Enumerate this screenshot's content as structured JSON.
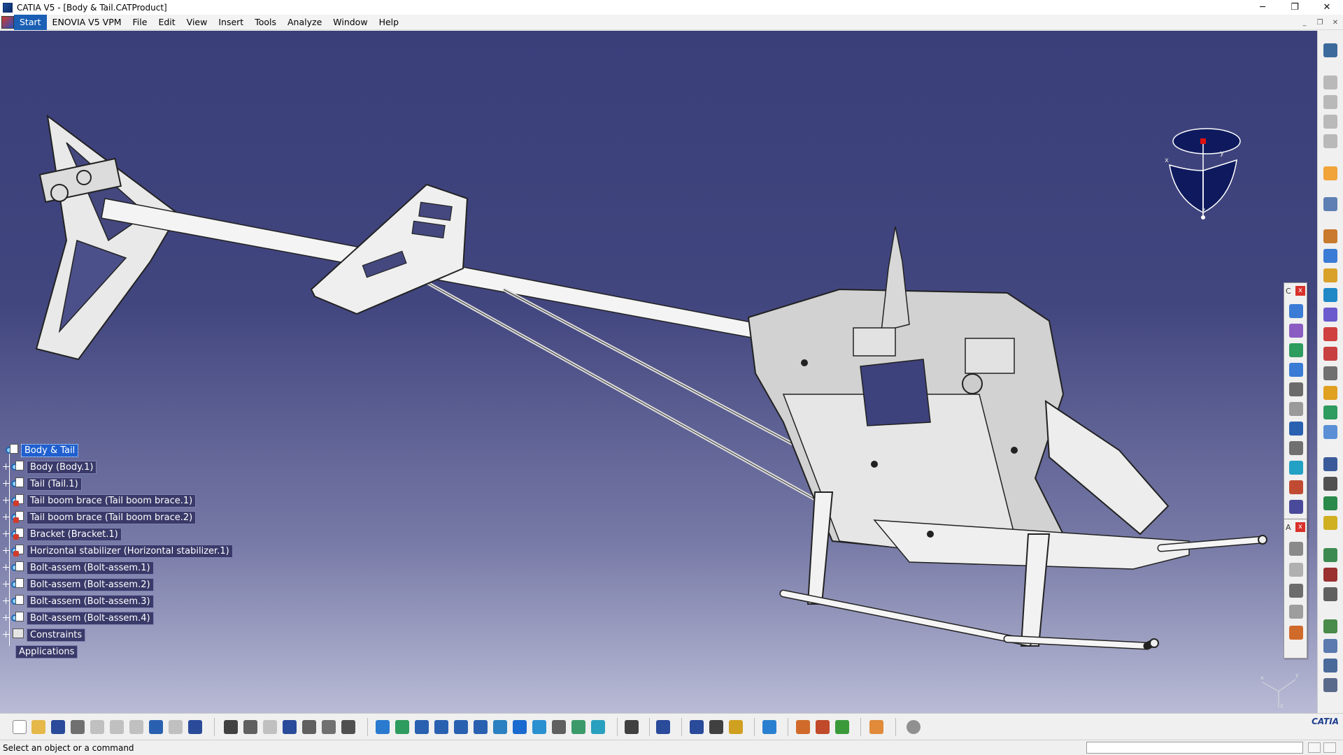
{
  "window": {
    "title": "CATIA V5 - [Body & Tail.CATProduct]",
    "controls": {
      "minimize": "─",
      "restore": "❐",
      "close": "✕"
    }
  },
  "menu": {
    "items": [
      "Start",
      "ENOVIA V5 VPM",
      "File",
      "Edit",
      "View",
      "Insert",
      "Tools",
      "Analyze",
      "Window",
      "Help"
    ],
    "active_index": 0
  },
  "tree": {
    "root": "Body & Tail",
    "children": [
      "Body (Body.1)",
      "Tail (Tail.1)",
      "Tail boom brace (Tail boom brace.1)",
      "Tail boom brace (Tail boom brace.2)",
      "Bracket (Bracket.1)",
      "Horizontal stabilizer (Horizontal stabilizer.1)",
      "Bolt-assem (Bolt-assem.1)",
      "Bolt-assem (Bolt-assem.2)",
      "Bolt-assem (Bolt-assem.3)",
      "Bolt-assem (Bolt-assem.4)",
      "Constraints",
      "Applications"
    ]
  },
  "floating_toolbars": [
    {
      "title": "C",
      "close": "x"
    },
    {
      "title": "A",
      "close": "x"
    }
  ],
  "compass": {
    "axis_x": "x",
    "axis_y": "y",
    "axis_z": "z"
  },
  "statusbar": {
    "text": "Select an object or a command",
    "input_value": ""
  },
  "branding": {
    "logo_text": "CATIA"
  },
  "colors": {
    "viewport_top": "#3a3e79",
    "viewport_bottom": "#b9bbd6",
    "tree_label_bg": "#3a3a6a",
    "tree_root_bg": "#1f5fcf",
    "menu_active": "#1a5fb4"
  }
}
